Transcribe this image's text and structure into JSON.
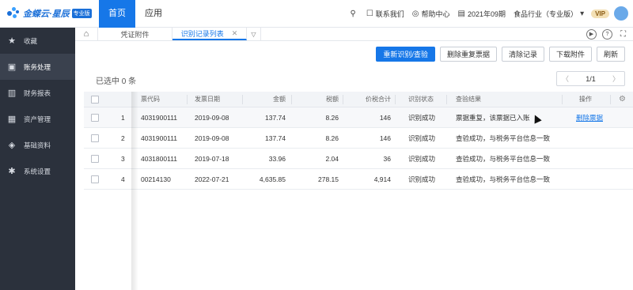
{
  "app": {
    "logo_text": "金蝶云·星辰",
    "logo_badge": "专业版",
    "nav": [
      {
        "label": "首页",
        "active": true
      },
      {
        "label": "应用",
        "active": false
      }
    ],
    "top_right": {
      "contact": "联系我们",
      "help": "帮助中心",
      "period": "2021年09期",
      "industry": "食品行业（专业版）",
      "vip": "VIP"
    }
  },
  "sidebar": {
    "items": [
      {
        "label": "收藏",
        "icon": "star-icon",
        "active": false
      },
      {
        "label": "账务处理",
        "icon": "ledger-icon",
        "active": true
      },
      {
        "label": "财务报表",
        "icon": "report-icon",
        "active": false
      },
      {
        "label": "资产管理",
        "icon": "asset-icon",
        "active": false
      },
      {
        "label": "基础资料",
        "icon": "layers-icon",
        "active": false
      },
      {
        "label": "系统设置",
        "icon": "gear-icon",
        "active": false
      }
    ]
  },
  "tabs": {
    "items": [
      {
        "label": "凭证附件",
        "active": false
      },
      {
        "label": "识别记录列表",
        "active": true
      }
    ]
  },
  "toolbar": {
    "recheck": "重新识别/查验",
    "delete_dup": "删除重复票据",
    "clear": "清除记录",
    "download": "下载附件",
    "refresh": "刷新"
  },
  "list": {
    "selected_count": "已选中 0 条",
    "pager": "1/1",
    "columns": [
      "票代码",
      "发票日期",
      "金额",
      "税额",
      "价税合计",
      "识别状态",
      "查验结果",
      "操作"
    ],
    "rows": [
      {
        "no": "1",
        "code": "4031900111",
        "date": "2019-09-08",
        "amount": "137.74",
        "tax": "8.26",
        "total": "146",
        "status": "识别成功",
        "result": "票据重复，该票据已入账",
        "action": "删除票据"
      },
      {
        "no": "2",
        "code": "4031900111",
        "date": "2019-09-08",
        "amount": "137.74",
        "tax": "8.26",
        "total": "146",
        "status": "识别成功",
        "result": "查验成功，与税务平台信息一致",
        "action": ""
      },
      {
        "no": "3",
        "code": "4031800111",
        "date": "2019-07-18",
        "amount": "33.96",
        "tax": "2.04",
        "total": "36",
        "status": "识别成功",
        "result": "查验成功，与税务平台信息一致",
        "action": ""
      },
      {
        "no": "4",
        "code": "00214130",
        "date": "2022-07-21",
        "amount": "4,635.85",
        "tax": "278.15",
        "total": "4,914",
        "status": "识别成功",
        "result": "查验成功，与税务平台信息一致",
        "action": ""
      }
    ]
  },
  "colors": {
    "accent": "#1677e8",
    "sidebar": "#2b313c"
  }
}
